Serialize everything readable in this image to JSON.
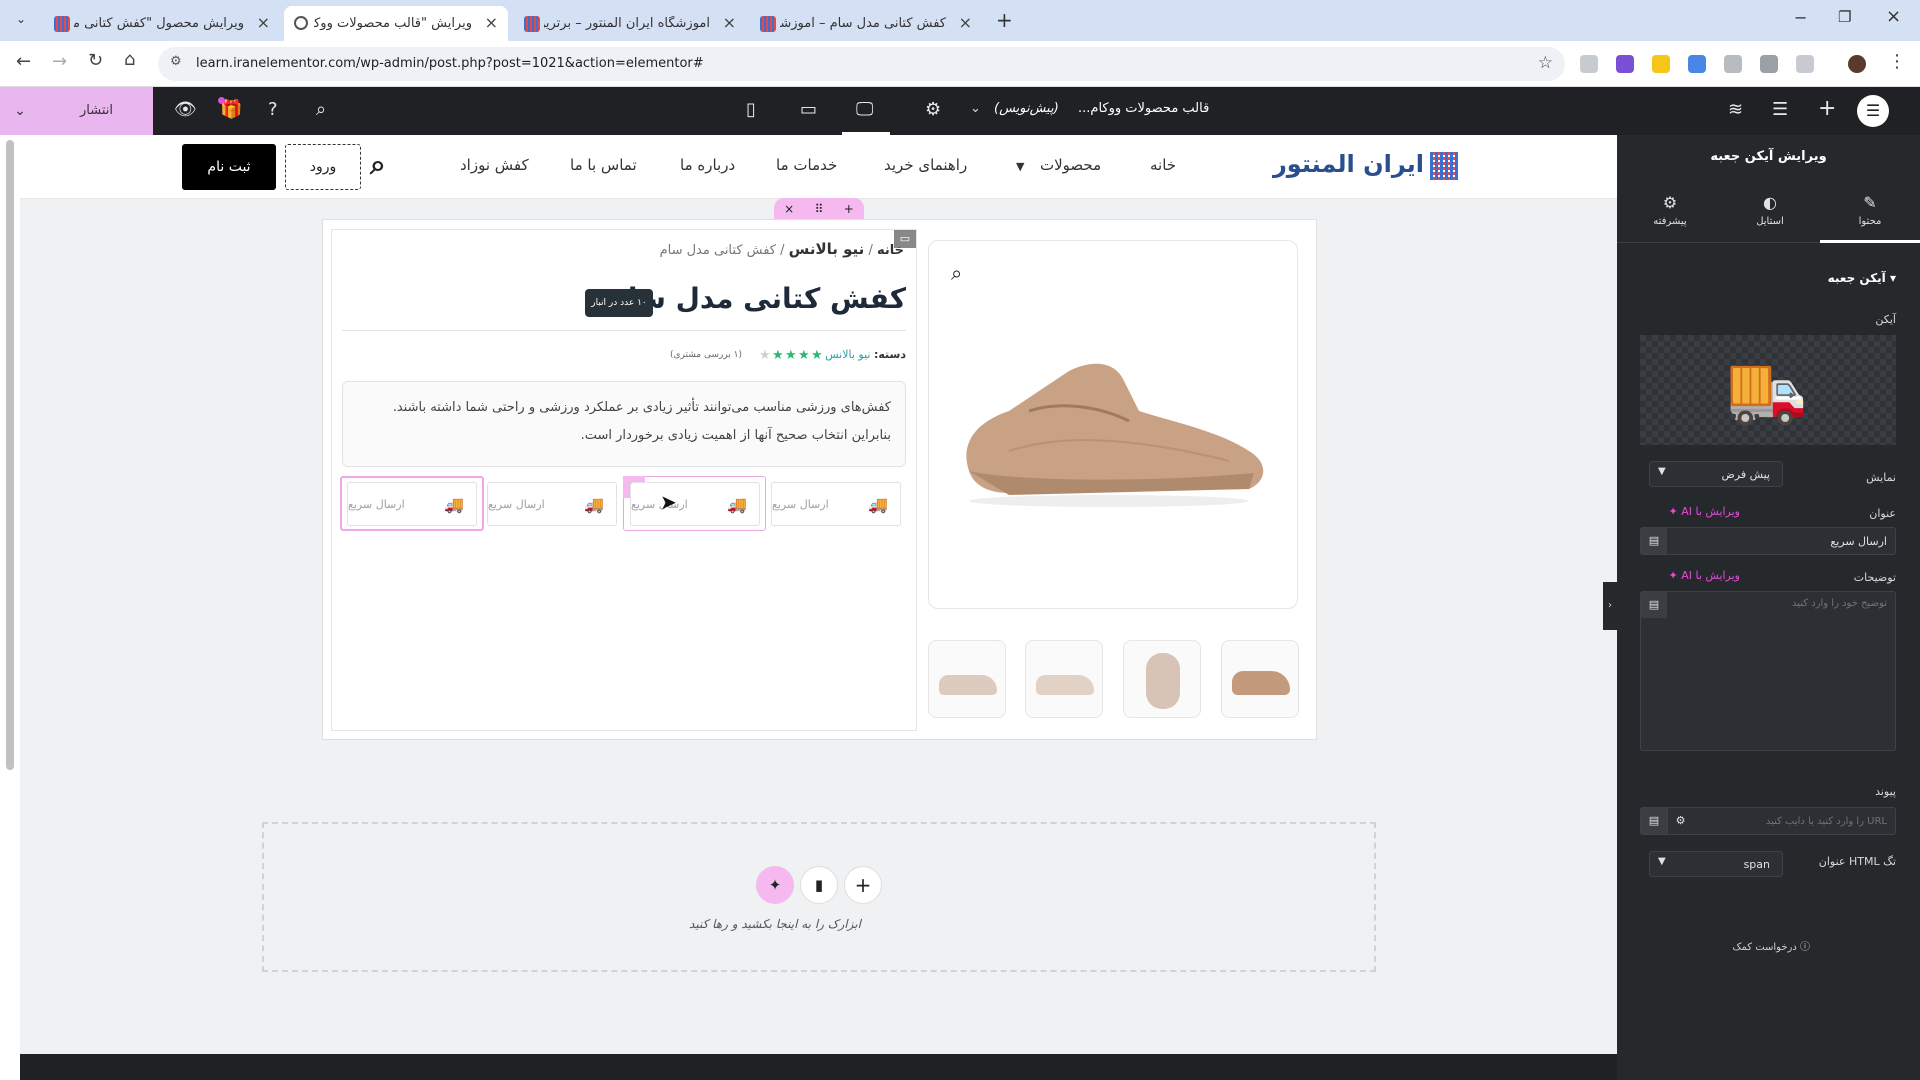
{
  "browser": {
    "tabs": [
      {
        "title": "ویرایش محصول \"کفش کتانی مدل",
        "active": false
      },
      {
        "title": "ویرایش \"قالب محصولات ووکامر...",
        "active": true
      },
      {
        "title": "آموزشگاه ایران المنتور – برترین فر...",
        "active": false
      },
      {
        "title": "کفش کتانی مدل سام – آموزشگاه",
        "active": false
      }
    ],
    "url": "learn.iranelementor.com/wp-admin/post.php?post=1021&action=elementor#"
  },
  "editor": {
    "publish_label": "انتشار",
    "doc_title": "قالب محصولات ووکام...",
    "doc_status": "(پیش‌نویس)"
  },
  "site": {
    "logo_text": "ایران المنتور",
    "nav": [
      "خانه",
      "محصولات",
      "راهنمای خرید",
      "خدمات ما",
      "درباره ما",
      "تماس با ما",
      "کفش نوزاد"
    ],
    "login": "ورود",
    "signup": "ثبت نام"
  },
  "product": {
    "breadcrumb_home": "خانه",
    "breadcrumb_sep": "/",
    "breadcrumb_cat": "نیو بالانس",
    "breadcrumb_current": "کفش کتانی مدل سام",
    "title": "کفش کتانی مدل سام",
    "stock_badge": "۱۰ عدد در انبار",
    "category_label": "دسته:",
    "category_value": "نیو بالانس",
    "rating": 4,
    "reviews": "(۱ بررسی مشتری)",
    "description": "کفش‌های ورزشی مناسب می‌توانند تأثیر زیادی بر عملکرد ورزشی و راحتی شما داشته باشند. بنابراین انتخاب صحیح آنها از اهمیت زیادی برخوردار است.",
    "features": [
      "ارسال سریع",
      "ارسال سریع",
      "ارسال سریع",
      "ارسال سریع"
    ]
  },
  "dropzone": {
    "text": "ابزارک را به اینجا بکشید و رها کنید"
  },
  "panel": {
    "header": "ویرایش آیکن جعبه",
    "tabs": [
      "محتوا",
      "استایل",
      "پیشرفته"
    ],
    "section": "آیکن جعبه",
    "icon_label": "آیکن",
    "view_label": "نمایش",
    "view_value": "پیش فرض",
    "title_label": "عنوان",
    "ai_label": "ویرایش با AI",
    "title_value": "ارسال سریع",
    "desc_label": "توضیحات",
    "desc_placeholder": "توضیح خود را وارد کنید",
    "link_label": "پیوند",
    "link_placeholder": "URL را وارد کنید یا دایب کنید",
    "html_tag_label": "تگ HTML عنوان",
    "html_tag_value": "span",
    "help": "درخواست کمک"
  },
  "colors": {
    "accent": "#e34cd8",
    "panel_bg": "#26292c",
    "publish_bg": "#e9b6f0"
  }
}
